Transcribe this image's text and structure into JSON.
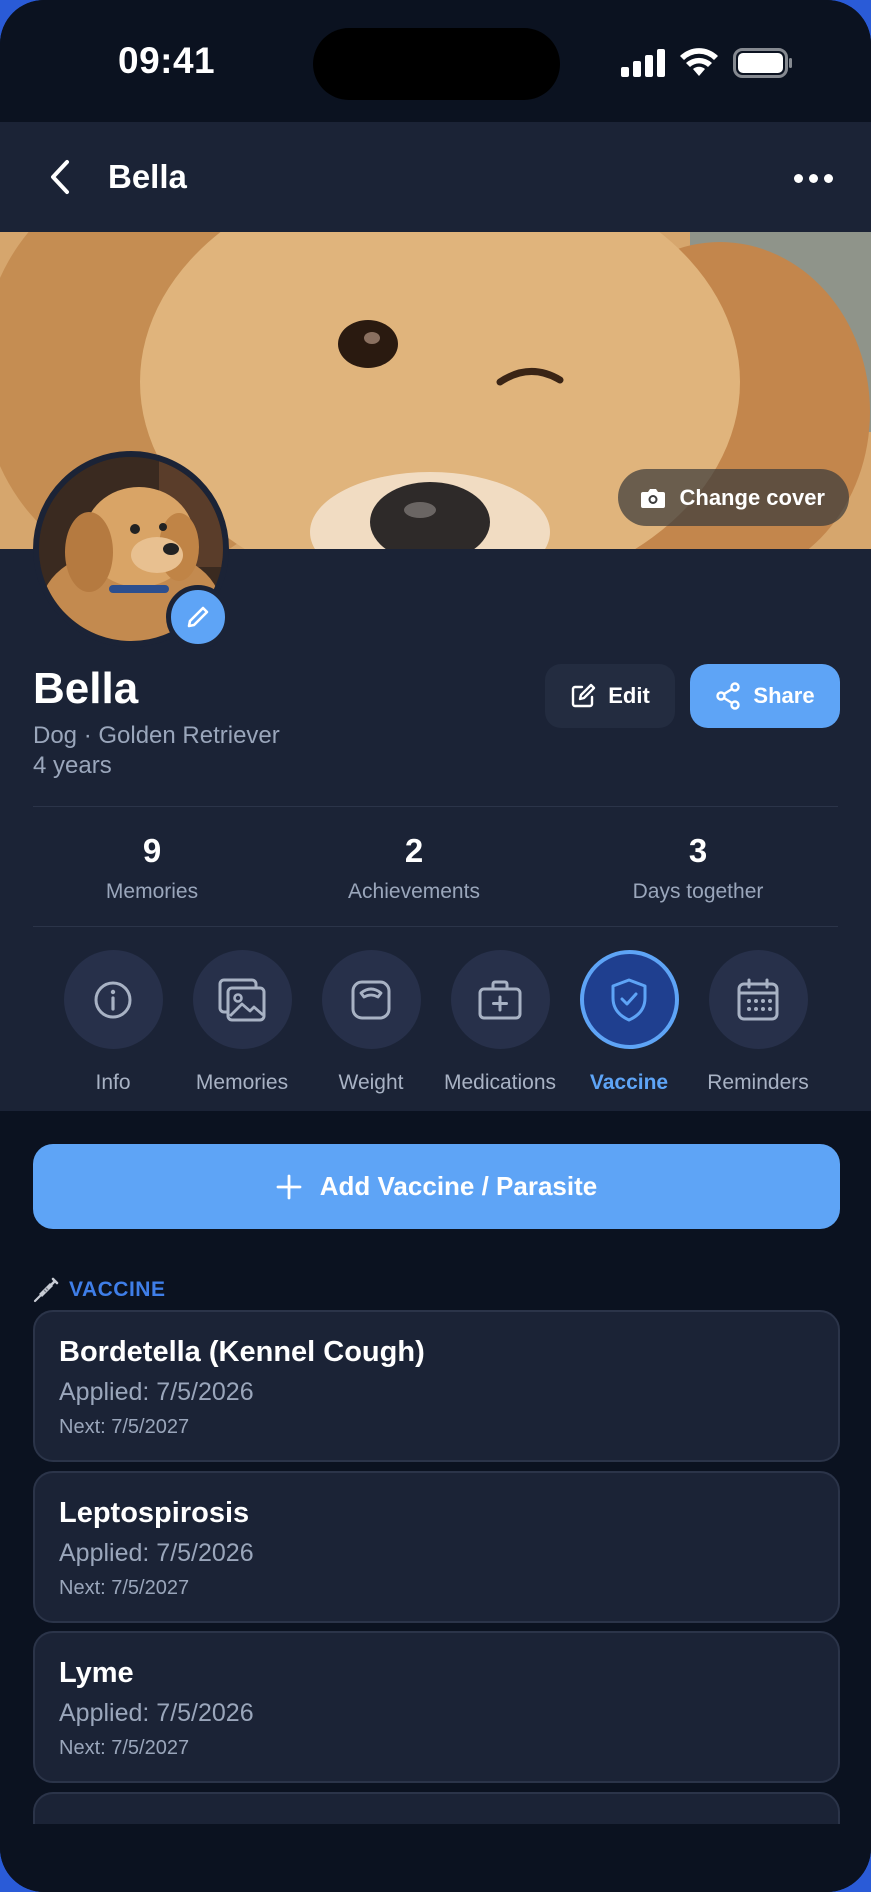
{
  "status_bar": {
    "time": "09:41"
  },
  "nav": {
    "title": "Bella"
  },
  "cover": {
    "change_cover_label": "Change cover"
  },
  "profile": {
    "name": "Bella",
    "breed": "Dog · Golden Retriever",
    "age": "4 years",
    "edit_label": "Edit",
    "share_label": "Share"
  },
  "stats": [
    {
      "value": "9",
      "label": "Memories"
    },
    {
      "value": "2",
      "label": "Achievements"
    },
    {
      "value": "3",
      "label": "Days together"
    }
  ],
  "tabs": [
    {
      "label": "Info",
      "icon": "info-icon"
    },
    {
      "label": "Memories",
      "icon": "image-icon"
    },
    {
      "label": "Weight",
      "icon": "scale-icon"
    },
    {
      "label": "Medications",
      "icon": "medkit-icon"
    },
    {
      "label": "Vaccine",
      "icon": "shield-check-icon",
      "active": true
    },
    {
      "label": "Reminders",
      "icon": "calendar-icon"
    }
  ],
  "add_button_label": "Add Vaccine / Parasite",
  "section": {
    "title": "VACCINE",
    "icon": "syringe-icon"
  },
  "vaccines": [
    {
      "name": "Bordetella (Kennel Cough)",
      "applied": "Applied: 7/5/2026",
      "next": "Next: 7/5/2027"
    },
    {
      "name": "Leptospirosis",
      "applied": "Applied: 7/5/2026",
      "next": "Next: 7/5/2027"
    },
    {
      "name": "Lyme",
      "applied": "Applied: 7/5/2026",
      "next": "Next: 7/5/2027"
    }
  ],
  "colors": {
    "accent": "#5ea4f6",
    "background": "#0b1220",
    "surface": "#1b2336",
    "section_title": "#3f7ee8"
  }
}
